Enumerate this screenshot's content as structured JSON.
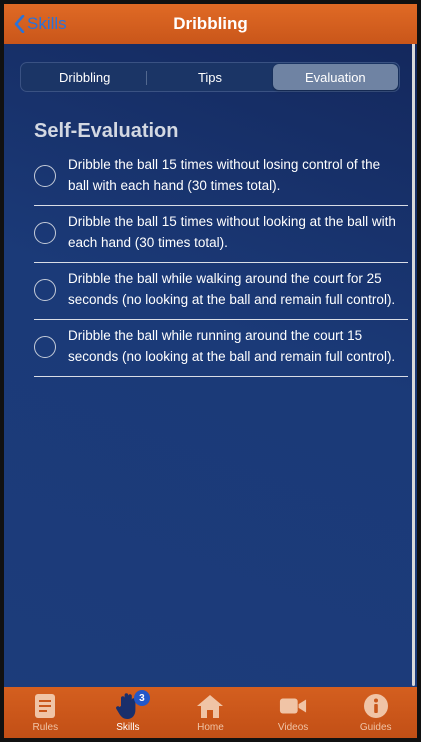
{
  "nav": {
    "back_label": "Skills",
    "title": "Dribbling"
  },
  "segments": [
    {
      "label": "Dribbling",
      "active": false
    },
    {
      "label": "Tips",
      "active": false
    },
    {
      "label": "Evaluation",
      "active": true
    }
  ],
  "section": {
    "title": "Self-Evaluation"
  },
  "checklist": [
    {
      "text": "Dribble the ball 15 times without losing control of the ball with each hand (30 times total).",
      "checked": false
    },
    {
      "text": "Dribble the ball 15 times without looking at the ball with each hand (30 times total).",
      "checked": false
    },
    {
      "text": "Dribble the ball while walking around the court for 25 seconds (no looking at the ball and remain full control).",
      "checked": false
    },
    {
      "text": "Dribble the ball while running around the court 15 seconds (no looking at the ball and remain full control).",
      "checked": false
    }
  ],
  "tabbar": {
    "items": [
      {
        "label": "Rules",
        "icon": "document-icon"
      },
      {
        "label": "Skills",
        "icon": "hand-icon",
        "badge": "3",
        "active": true
      },
      {
        "label": "Home",
        "icon": "house-icon"
      },
      {
        "label": "Videos",
        "icon": "video-camera-icon"
      },
      {
        "label": "Guides",
        "icon": "info-icon"
      }
    ]
  },
  "colors": {
    "accent_orange": "#d45f1f",
    "background_navy": "#1b3a78",
    "back_link_blue": "#2a72d9",
    "badge_blue": "#2458c8"
  }
}
